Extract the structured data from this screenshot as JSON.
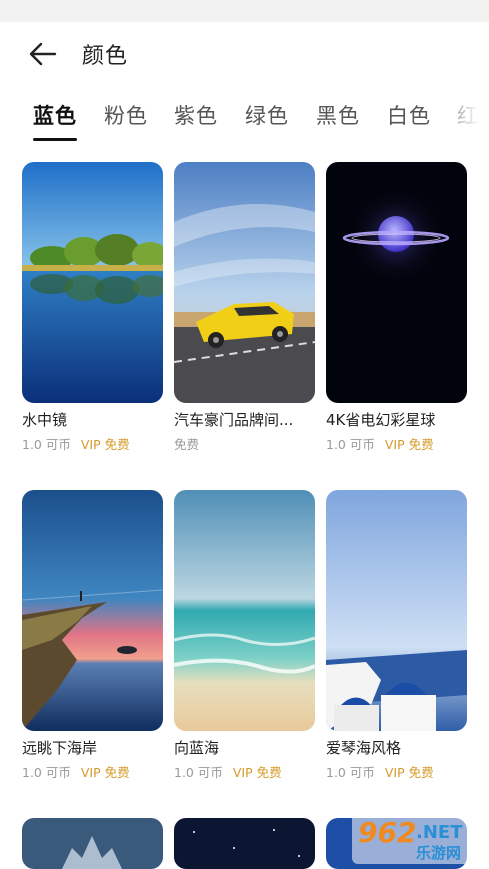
{
  "header": {
    "title": "颜色"
  },
  "tabs": [
    {
      "label": "蓝色",
      "active": true
    },
    {
      "label": "粉色",
      "active": false
    },
    {
      "label": "紫色",
      "active": false
    },
    {
      "label": "绿色",
      "active": false
    },
    {
      "label": "黑色",
      "active": false
    },
    {
      "label": "白色",
      "active": false
    },
    {
      "label": "红",
      "active": false
    }
  ],
  "wallpapers": [
    {
      "title": "水中镜",
      "price": "1.0 可币",
      "vip": "VIP 免费"
    },
    {
      "title": "汽车豪门品牌间...",
      "price": "免费",
      "vip": ""
    },
    {
      "title": "4K省电幻彩星球",
      "price": "1.0 可币",
      "vip": "VIP 免费"
    },
    {
      "title": "远眺下海岸",
      "price": "1.0 可币",
      "vip": "VIP 免费"
    },
    {
      "title": "向蓝海",
      "price": "1.0 可币",
      "vip": "VIP 免费"
    },
    {
      "title": "爱琴海风格",
      "price": "1.0 可币",
      "vip": "VIP 免费"
    }
  ],
  "watermark": {
    "number": "962",
    "suffix": ".NET",
    "site": "乐游网"
  },
  "colors": {
    "accent_vip": "#d59a28",
    "text_primary": "#222222",
    "text_secondary": "#9a9a9a"
  }
}
